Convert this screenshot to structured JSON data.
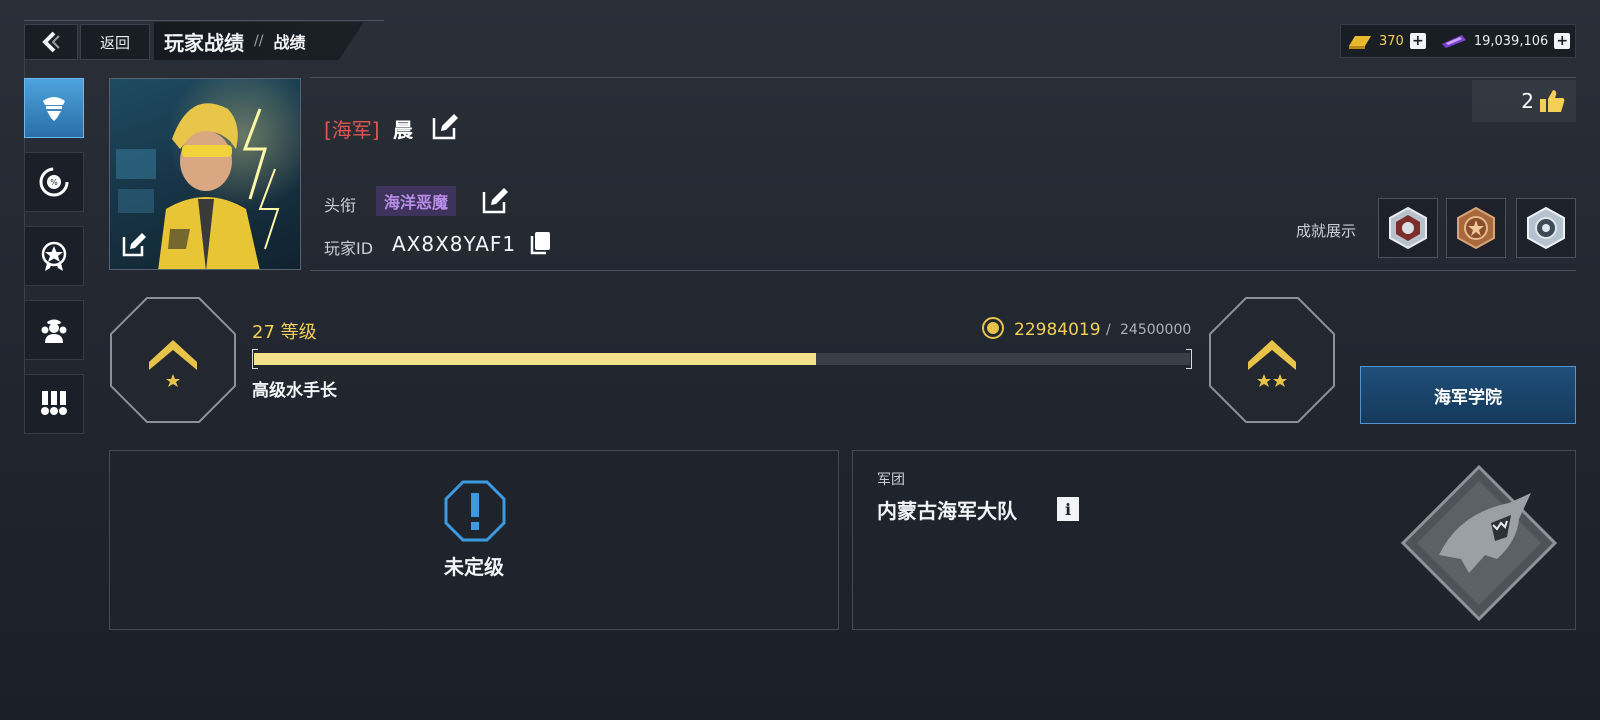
{
  "header": {
    "back_label": "返回",
    "title": "玩家战绩",
    "separator": "//",
    "subtitle": "战绩"
  },
  "currency": {
    "gold": "370",
    "gems": "19,039,106"
  },
  "sidebar": {
    "items": [
      {
        "icon": "navy-officer-icon",
        "active": true
      },
      {
        "icon": "percent-dial-icon",
        "active": false
      },
      {
        "icon": "star-badge-icon",
        "active": false
      },
      {
        "icon": "crew-icon",
        "active": false
      },
      {
        "icon": "medal-ribbons-icon",
        "active": false
      }
    ]
  },
  "profile": {
    "faction": "[海军]",
    "name": "晨",
    "title_label": "头衔",
    "title_value": "海洋恶魔",
    "id_label": "玩家ID",
    "id_value": "AX8X8YAF1",
    "likes": "2",
    "achievements_label": "成就展示"
  },
  "rank": {
    "level_text": "27 等级",
    "xp_current": "22984019",
    "xp_slash": "/",
    "xp_max": "24500000",
    "xp_fraction": 0.6,
    "rank_name": "高级水手长",
    "academy_button": "海军学院"
  },
  "ranked": {
    "status": "未定级"
  },
  "legion": {
    "label": "军团",
    "name": "内蒙古海军大队",
    "info_glyph": "i"
  },
  "colors": {
    "accent_gold": "#f3cf56",
    "faction_red": "#e05550",
    "title_purple": "#b88ee8",
    "active_blue": "#4da2dd"
  }
}
